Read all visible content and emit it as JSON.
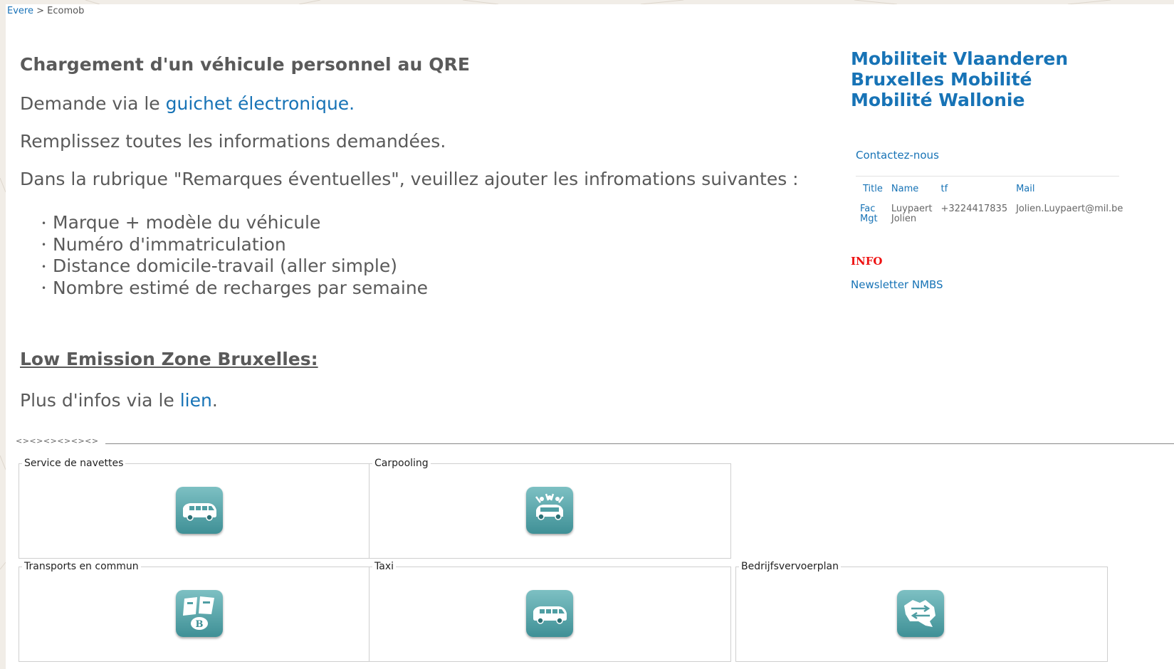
{
  "breadcrumb": {
    "home": "Evere",
    "separator": ">",
    "current": "Ecomob"
  },
  "main": {
    "heading": "Chargement d'un véhicule personnel au QRE",
    "p1_text": "Demande via le ",
    "p1_link": "guichet électronique.",
    "p2": "Remplissez toutes les informations demandées.",
    "p3": "Dans la rubrique \"Remarques éventuelles\", veuillez ajouter les infromations suivantes :",
    "bullets": [
      "Marque + modèle du véhicule",
      "Numéro d'immatriculation",
      "Distance domicile-travail (aller simple)",
      "Nombre estimé de recharges par semaine"
    ],
    "lez_heading": "Low Emission Zone Bruxelles:",
    "p4_text": "Plus d'infos via le ",
    "p4_link": "lien",
    "p4_end": "."
  },
  "sidebar": {
    "regions": [
      "Mobiliteit Vlaanderen",
      "Bruxelles Mobilité",
      "Mobilité Wallonie"
    ],
    "contact_link": "Contactez-nous",
    "table_headers": [
      "Title",
      "Name",
      "tf",
      "Mail"
    ],
    "contact_row": {
      "title_line1": "Fac",
      "title_line2": "Mgt",
      "name_line1": "Luypaert",
      "name_line2": "Jolien",
      "phone": "+3224417835",
      "mail": "Jolien.Luypaert@mil.be"
    },
    "info_label": "INFO",
    "newsletter": "Newsletter NMBS"
  },
  "separator_text": "<><><><><><>",
  "tiles": [
    {
      "label": "Service de navettes",
      "icon": "minibus-icon"
    },
    {
      "label": "Carpooling",
      "icon": "carpooling-icon"
    },
    {
      "label": "Transports en commun",
      "icon": "train-sncb-icon"
    },
    {
      "label": "Taxi",
      "icon": "minibus-icon"
    },
    {
      "label": "Bedrijfsvervoerplan",
      "icon": "belgium-map-icon"
    }
  ],
  "colors": {
    "link": "#1773b6",
    "text": "#5a5a5a",
    "info": "#ee1111",
    "icon_teal": "#4f9ea3",
    "background": "#f1ede7"
  }
}
